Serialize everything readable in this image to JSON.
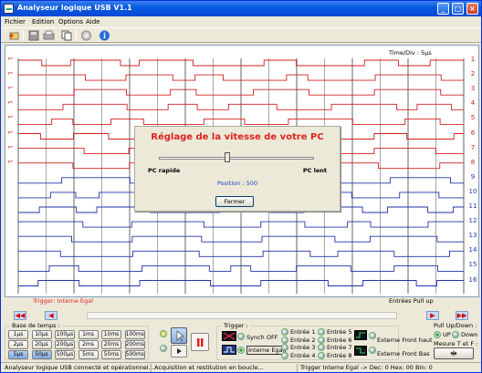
{
  "window": {
    "title": "Analyseur logique USB V1.1"
  },
  "menu": [
    "Fichier",
    "Edition",
    "Options",
    "Aide"
  ],
  "toolbar_icons": [
    "open-icon",
    "save-icon",
    "print-icon",
    "copy-icon",
    "settings-icon",
    "info-icon"
  ],
  "scope": {
    "time_div": "Time/Div : 5µs",
    "trigger_label": "Trigger: Interne Egal",
    "pullup_label": "Entrées Pull up",
    "channels": [
      "1",
      "2",
      "3",
      "4",
      "5",
      "6",
      "7",
      "8",
      "9",
      "10",
      "11",
      "12",
      "13",
      "14",
      "15",
      "16"
    ]
  },
  "dialog": {
    "title": "Réglage de la vitesse de votre PC",
    "left_label": "PC rapide",
    "right_label": "PC lent",
    "position": "Position : 500",
    "button": "Fermer",
    "slider_value": 500
  },
  "timebase": {
    "title": "Base de temps :",
    "buttons": [
      "1µs",
      "10µs",
      "100µs",
      "1ms",
      "10ms",
      "100ms",
      "2µs",
      "20µs",
      "200µs",
      "2ms",
      "20ms",
      "200ms",
      "5µs",
      "50µs",
      "500µs",
      "5ms",
      "50ms",
      "500ms"
    ],
    "selected": [
      "5µs",
      "50µs"
    ]
  },
  "trigger": {
    "title": "Trigger :",
    "synch": "Synch OFF",
    "interne": "Interne Egal",
    "entries": [
      "Entrée 1",
      "Entrée 2",
      "Entrée 3",
      "Entrée 4",
      "Entrée 5",
      "Entrée 6",
      "Entrée 7",
      "Entrée 8"
    ],
    "ext_high": "Externe Front haut",
    "ext_low": "Externe Front Bas"
  },
  "pullup": {
    "title": "Pull Up/Down :",
    "up": "UP",
    "down": "Down",
    "measure": "Mesure T et F :"
  },
  "status": {
    "left": "Analyseur logique USB connecté et opérationnel...",
    "middle": "Acquisition et restitution en boucle...",
    "right": "Trigger Interne Egal -> Dec: 0   Hex: 00   Bin: 0"
  },
  "colors": {
    "red_channels": "#d22222",
    "blue_channels": "#2233aa",
    "title_blue": "#0a5ae0"
  }
}
